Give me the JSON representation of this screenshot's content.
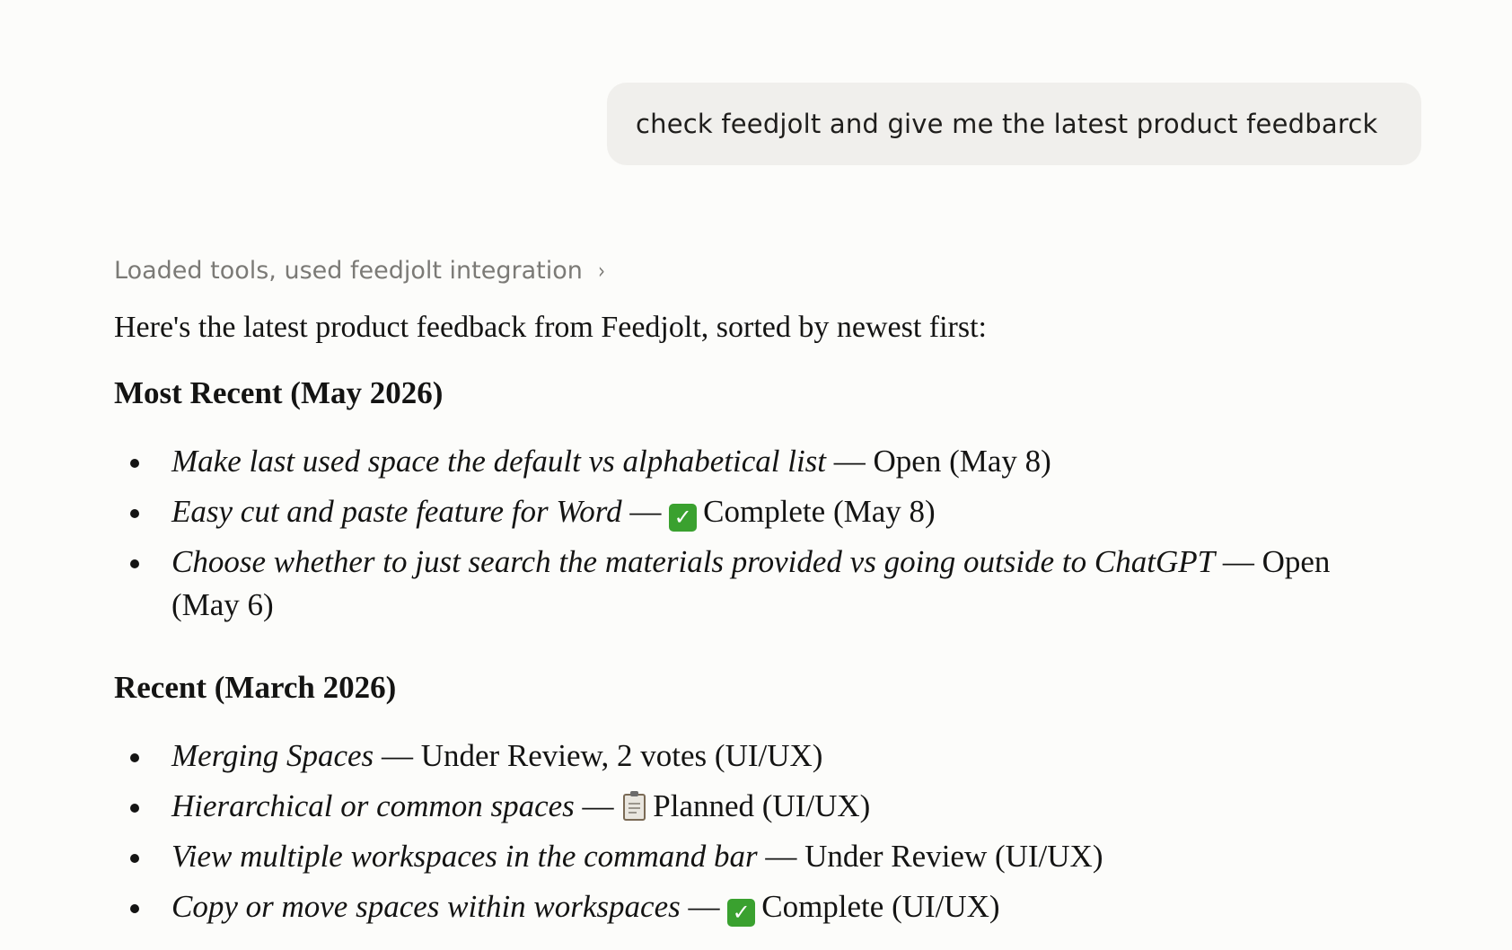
{
  "user_message": "check feedjolt and give me the latest product feedbarck",
  "tool_status": {
    "label": "Loaded tools, used feedjolt integration",
    "chevron": "›"
  },
  "response": {
    "intro": "Here's the latest product feedback from Feedjolt, sorted by newest first:",
    "sections": [
      {
        "heading": "Most Recent (May 2026)",
        "items": [
          {
            "title": "Make last used space the default vs alphabetical list",
            "sep": " — ",
            "icon": "",
            "status": "Open (May 8)"
          },
          {
            "title": "Easy cut and paste feature for Word",
            "sep": " — ",
            "icon": "check-icon",
            "status": "Complete (May 8)"
          },
          {
            "title": "Choose whether to just search the materials provided vs going outside to ChatGPT",
            "sep": " — ",
            "icon": "",
            "status": "Open (May 6)"
          }
        ]
      },
      {
        "heading": "Recent (March 2026)",
        "items": [
          {
            "title": "Merging Spaces",
            "sep": " — ",
            "icon": "",
            "status": "Under Review, 2 votes (UI/UX)"
          },
          {
            "title": "Hierarchical or common spaces",
            "sep": " — ",
            "icon": "clipboard-icon",
            "status": "Planned (UI/UX)"
          },
          {
            "title": "View multiple workspaces in the command bar",
            "sep": " — ",
            "icon": "",
            "status": "Under Review (UI/UX)"
          },
          {
            "title": "Copy or move spaces within workspaces",
            "sep": " — ",
            "icon": "check-icon",
            "status": "Complete (UI/UX)"
          }
        ]
      }
    ]
  },
  "colors": {
    "background": "#fcfcfa",
    "user_bubble": "#f0efec",
    "muted_text": "#7b7a76",
    "check_green": "#3aa12f"
  }
}
